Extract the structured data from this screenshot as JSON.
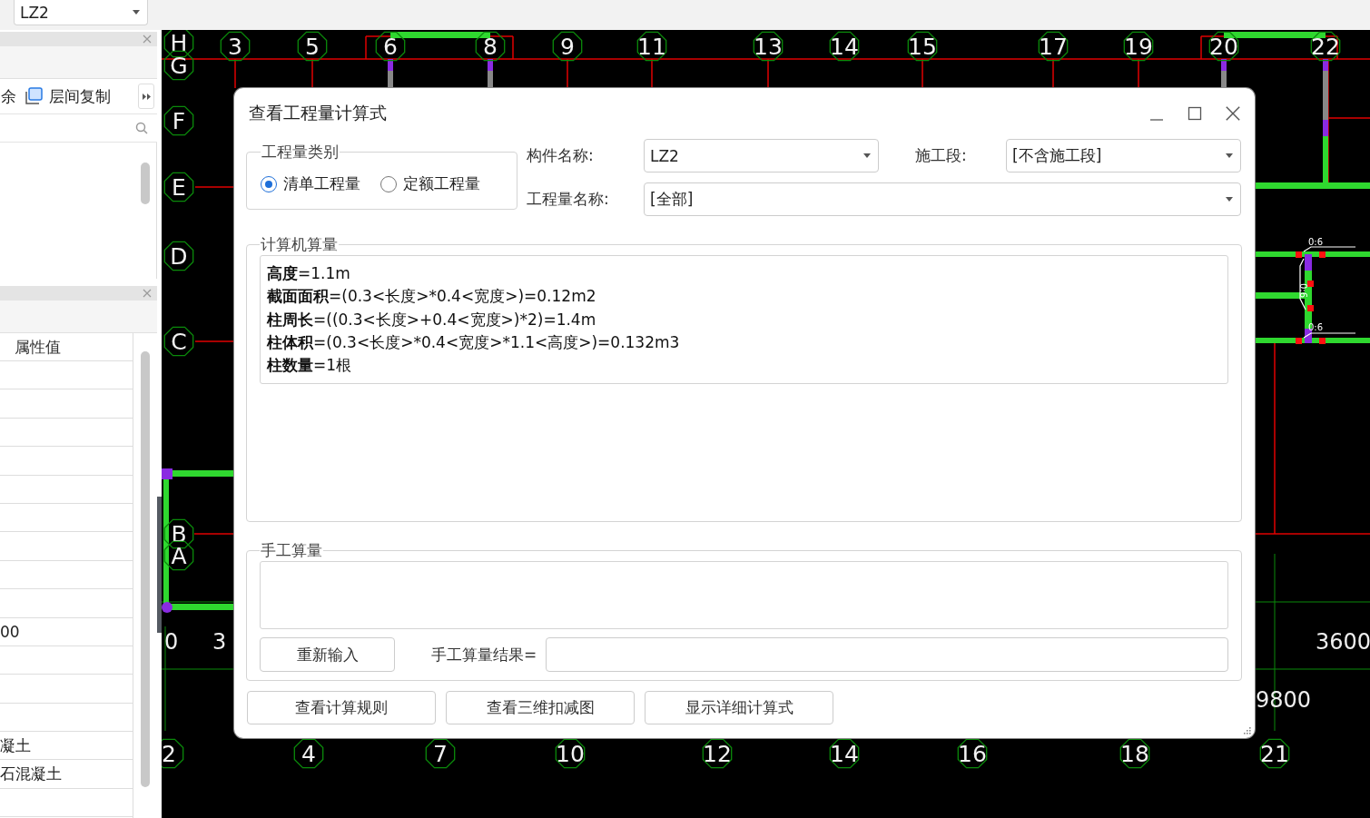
{
  "top_bar": {
    "component_select": {
      "value": "LZ2"
    }
  },
  "component_panel": {
    "actions": [
      {
        "kind": "text",
        "label": "余"
      },
      {
        "kind": "copy",
        "label": "层间复制"
      }
    ]
  },
  "property_panel": {
    "column_header": "属性值",
    "rows": [
      {
        "kind": "empty"
      },
      {
        "kind": "empty"
      },
      {
        "kind": "empty"
      },
      {
        "kind": "empty"
      },
      {
        "kind": "empty"
      },
      {
        "kind": "empty"
      },
      {
        "kind": "empty"
      },
      {
        "kind": "empty"
      },
      {
        "kind": "empty"
      },
      {
        "kind": "value",
        "value": "00"
      },
      {
        "kind": "empty"
      },
      {
        "kind": "empty"
      },
      {
        "kind": "empty"
      },
      {
        "kind": "value",
        "value": "凝土"
      },
      {
        "kind": "value",
        "value": "石混凝土"
      },
      {
        "kind": "empty"
      }
    ]
  },
  "canvas": {
    "top_axes": [
      "3",
      "5",
      "6",
      "8",
      "9",
      "11",
      "13",
      "14",
      "15",
      "17",
      "19",
      "20",
      "22"
    ],
    "left_axes": [
      "H",
      "G",
      "F",
      "E",
      "D",
      "C",
      "B",
      "A"
    ],
    "bottom_axes": [
      "2",
      "4",
      "7",
      "10",
      "12",
      "14",
      "16",
      "18",
      "21"
    ],
    "dimension_labels": [
      "0",
      "3",
      "3600",
      "9800"
    ],
    "wall_tags": [
      "0:6",
      "0:6",
      "0:6"
    ]
  },
  "dialog": {
    "title": "查看工程量计算式",
    "quantity_type": {
      "legend": "工程量类别",
      "options": [
        {
          "label": "清单工程量",
          "selected": true
        },
        {
          "label": "定额工程量",
          "selected": false
        }
      ]
    },
    "component_name": {
      "label": "构件名称:",
      "value": "LZ2"
    },
    "stage": {
      "label": "施工段:",
      "value": "[不含施工段]"
    },
    "quantity_name": {
      "label": "工程量名称:",
      "value": "[全部]"
    },
    "computed": {
      "legend": "计算机算量",
      "lines": [
        "**高度**=1.1m",
        "**截面面积**=(0.3<长度>*0.4<宽度>)=0.12m2",
        "**柱周长**=((0.3<长度>+0.4<宽度>)*2)=1.4m",
        "**柱体积**=(0.3<长度>*0.4<宽度>*1.1<高度>)=0.132m3",
        "**柱数量**=1根"
      ]
    },
    "manual": {
      "legend": "手工算量",
      "reset_button": "重新输入",
      "result_label": "手工算量结果="
    },
    "buttons": [
      "查看计算规则",
      "查看三维扣减图",
      "显示详细计算式"
    ]
  }
}
